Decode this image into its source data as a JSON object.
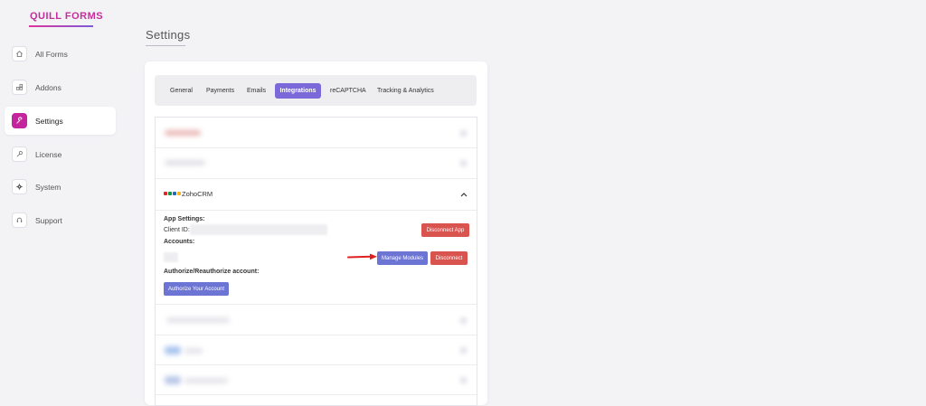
{
  "brand": {
    "name": "QUILL FORMS"
  },
  "sidebar": {
    "items": [
      {
        "label": "All Forms",
        "icon": "home-icon"
      },
      {
        "label": "Addons",
        "icon": "addons-icon"
      },
      {
        "label": "Settings",
        "icon": "wrench-icon",
        "active": true
      },
      {
        "label": "License",
        "icon": "key-icon"
      },
      {
        "label": "System",
        "icon": "gear-icon"
      },
      {
        "label": "Support",
        "icon": "support-icon"
      }
    ]
  },
  "page": {
    "title": "Settings"
  },
  "tabs": [
    {
      "label": "General"
    },
    {
      "label": "Payments"
    },
    {
      "label": "Emails"
    },
    {
      "label": "Integrations",
      "active": true
    },
    {
      "label": "reCAPTCHA"
    },
    {
      "label": "Tracking & Analytics"
    }
  ],
  "integration": {
    "name": "ZohoCRM",
    "app_settings_label": "App Settings:",
    "client_id_label": "Client ID:",
    "disconnect_app_label": "Disconnect App",
    "accounts_label": "Accounts:",
    "manage_modules_label": "Manage Modules",
    "disconnect_label": "Disconnect",
    "authorize_heading": "Authorize/Reauthorize account:",
    "authorize_button_label": "Authorize Your Account"
  },
  "colors": {
    "accent": "#7b68d9",
    "brand": "#c4249c",
    "danger": "#d9534f",
    "button_primary": "#6c75d4"
  }
}
